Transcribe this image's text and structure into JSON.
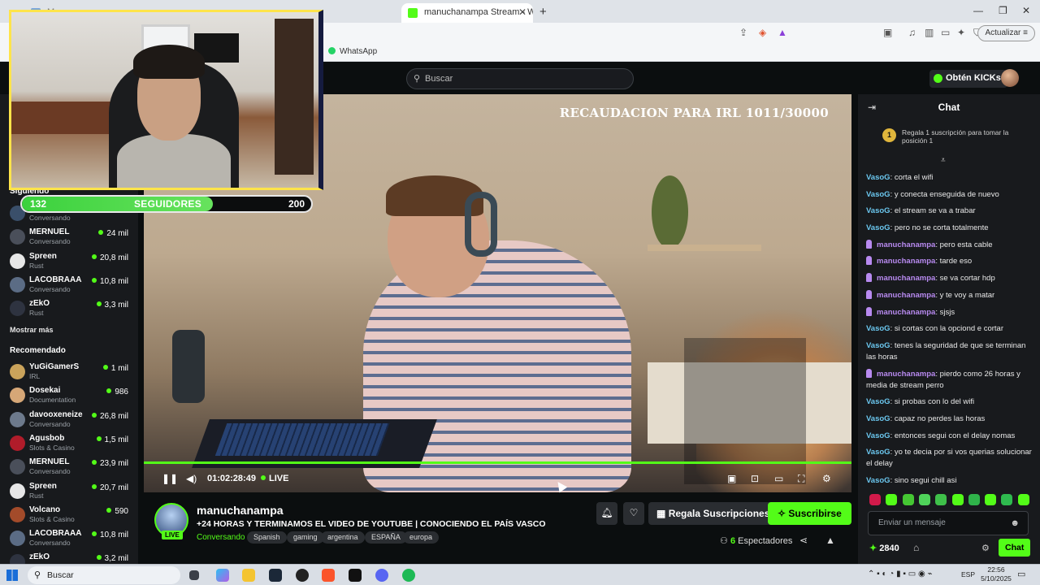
{
  "browser": {
    "tabs": [
      {
        "label": "Ma...",
        "active": false
      },
      {
        "label": "manuchanampa Stream - Wa",
        "active": true
      }
    ],
    "update_label": "Actualizar",
    "bookmark": "WhatsApp"
  },
  "header": {
    "search_placeholder": "Buscar",
    "kicks_button": "Obtén KICKs"
  },
  "sidebar": {
    "following_heading": "Siguiendo",
    "following": [
      {
        "name": "",
        "category": "Conversando",
        "viewers": "",
        "avatar_color": "#3a4f6a"
      },
      {
        "name": "MERNUEL",
        "category": "Conversando",
        "viewers": "24 mil",
        "avatar_color": "#4a4f5a"
      },
      {
        "name": "Spreen",
        "category": "Rust",
        "viewers": "20,8 mil",
        "avatar_color": "#e7e7e7"
      },
      {
        "name": "LACOBRAAA",
        "category": "Conversando",
        "viewers": "10,8 mil",
        "avatar_color": "#5b6c85"
      },
      {
        "name": "zEkO",
        "category": "Rust",
        "viewers": "3,3 mil",
        "avatar_color": "#2e3340"
      }
    ],
    "show_more": "Mostrar más",
    "recommended_heading": "Recomendado",
    "recommended": [
      {
        "name": "YuGiGamerS",
        "category": "IRL",
        "viewers": "1 mil",
        "avatar_color": "#caa35b"
      },
      {
        "name": "Dosekai",
        "category": "Documentation",
        "viewers": "986",
        "avatar_color": "#d6a777"
      },
      {
        "name": "davooxeneize",
        "category": "Conversando",
        "viewers": "26,8 mil",
        "avatar_color": "#6d7a8c"
      },
      {
        "name": "Agusbob",
        "category": "Slots & Casino",
        "viewers": "1,5 mil",
        "avatar_color": "#b01c2a"
      },
      {
        "name": "MERNUEL",
        "category": "Conversando",
        "viewers": "23,9 mil",
        "avatar_color": "#4a4f5a"
      },
      {
        "name": "Spreen",
        "category": "Rust",
        "viewers": "20,7 mil",
        "avatar_color": "#e7e7e7"
      },
      {
        "name": "Volcano",
        "category": "Slots & Casino",
        "viewers": "590",
        "avatar_color": "#a34b2a"
      },
      {
        "name": "LACOBRAAA",
        "category": "Conversando",
        "viewers": "10,8 mil",
        "avatar_color": "#5b6c85"
      },
      {
        "name": "zEkO",
        "category": "",
        "viewers": "3,2 mil",
        "avatar_color": "#2e3340"
      }
    ]
  },
  "overlay": {
    "goal_current": "132",
    "goal_label": "SEGUIDORES",
    "goal_target": "200",
    "goal_fraction": 0.66,
    "raise_title": "RECAUDACION PARA IRL 1011/30000"
  },
  "player": {
    "time": "01:02:28:49",
    "live_label": "LIVE"
  },
  "stream": {
    "streamer": "manuchanampa",
    "live_badge": "LIVE",
    "title": "+24 HORAS Y TERMINAMOS EL VIDEO DE YOUTUBE | CONOCIENDO EL PAÍS VASCO",
    "category": "Conversando",
    "tags": [
      "Spanish",
      "gaming",
      "argentina",
      "ESPAÑA",
      "europa"
    ],
    "gift_button": "Regala Suscripciones",
    "subscribe_button": "Suscribirse",
    "viewers_count": "6",
    "viewers_label": "Espectadores"
  },
  "chat": {
    "title": "Chat",
    "gift_banner": "Regala 1 suscripción para tomar la posición 1",
    "rank": "1",
    "messages": [
      {
        "user": "VasoG",
        "text": "corta el wifi",
        "mod": false
      },
      {
        "user": "VasoG",
        "text": "y conecta enseguida de nuevo",
        "mod": false
      },
      {
        "user": "VasoG",
        "text": "el stream se va a trabar",
        "mod": false
      },
      {
        "user": "VasoG",
        "text": "pero no se corta totalmente",
        "mod": false
      },
      {
        "user": "manuchanampa",
        "text": "pero esta cable",
        "mod": true
      },
      {
        "user": "manuchanampa",
        "text": "tarde eso",
        "mod": true
      },
      {
        "user": "manuchanampa",
        "text": "se va cortar hdp",
        "mod": true
      },
      {
        "user": "manuchanampa",
        "text": "y te voy a matar",
        "mod": true
      },
      {
        "user": "manuchanampa",
        "text": "sjsjs",
        "mod": true
      },
      {
        "user": "VasoG",
        "text": "si cortas con la opciond e cortar",
        "mod": false
      },
      {
        "user": "VasoG",
        "text": "tenes la seguridad de que se terminan las horas",
        "mod": false
      },
      {
        "user": "manuchanampa",
        "text": "pierdo como 26 horas y media de stream perro",
        "mod": true
      },
      {
        "user": "VasoG",
        "text": "si probas con lo del wifi",
        "mod": false
      },
      {
        "user": "VasoG",
        "text": "capaz no perdes las horas",
        "mod": false
      },
      {
        "user": "VasoG",
        "text": "entonces segui con el delay nomas",
        "mod": false
      },
      {
        "user": "VasoG",
        "text": "yo te decia por si vos querias solucionar el delay",
        "mod": false
      },
      {
        "user": "VasoG",
        "text": "sino segui chill asi",
        "mod": false
      }
    ],
    "input_placeholder": "Enviar un mensaje",
    "kicks": "2840",
    "send_button": "Chat"
  },
  "taskbar": {
    "search_placeholder": "Buscar",
    "language": "ESP",
    "time": "22:56",
    "date": "5/10/2025"
  }
}
